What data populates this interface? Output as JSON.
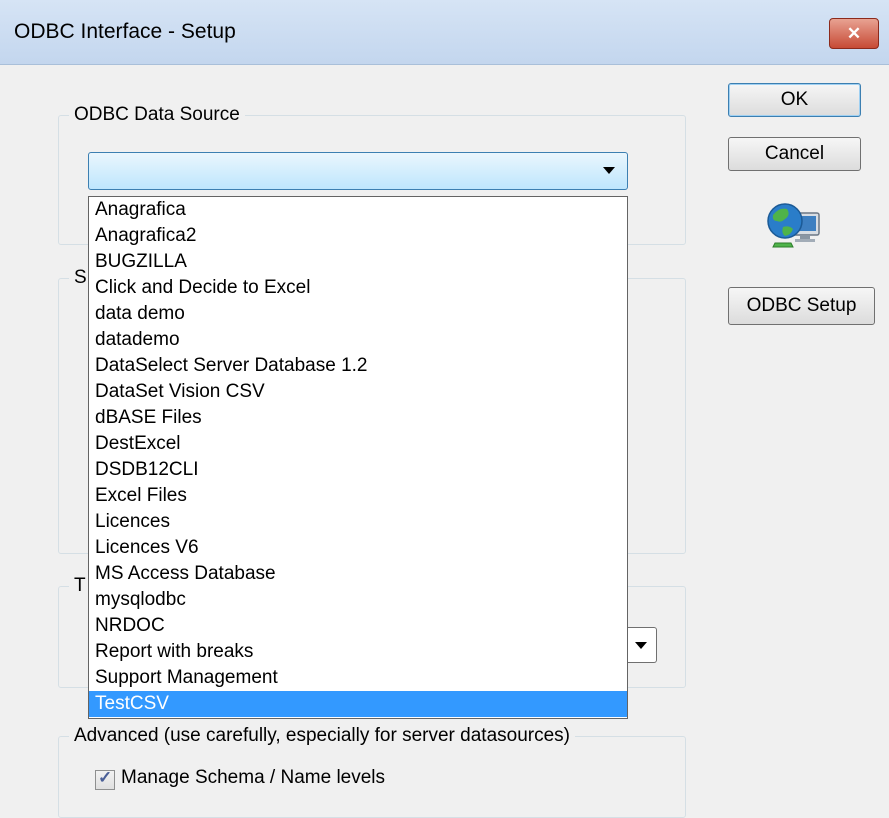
{
  "window": {
    "title": "ODBC Interface - Setup",
    "close_symbol": "✕"
  },
  "buttons": {
    "ok_label": "OK",
    "cancel_label": "Cancel",
    "odbc_setup_label": "ODBC Setup"
  },
  "icons": {
    "network": "globe-computer-icon"
  },
  "data_source_group": {
    "legend": "ODBC Data Source",
    "selected_value": ""
  },
  "hidden_groups": {
    "second_group_legend_fragment": "S",
    "third_group_legend_fragment": "T"
  },
  "dropdown": {
    "options": [
      "Anagrafica",
      "Anagrafica2",
      "BUGZILLA",
      "Click and Decide to Excel",
      "data demo",
      "datademo",
      "DataSelect Server Database 1.2",
      "DataSet Vision CSV",
      "dBASE Files",
      "DestExcel",
      "DSDB12CLI",
      "Excel Files",
      "Licences",
      "Licences V6",
      "MS Access Database",
      "mysqlodbc",
      "NRDOC",
      "Report with breaks",
      "Support Management",
      "TestCSV"
    ],
    "highlighted": "TestCSV"
  },
  "advanced_group": {
    "legend": "Advanced (use carefully, especially for server datasources)",
    "manage_schema_label": "Manage Schema / Name levels",
    "manage_schema_checked": true
  },
  "colors": {
    "highlight": "#3399ff",
    "title_bar": "#c3d6ee",
    "close_button": "#c74a35"
  }
}
